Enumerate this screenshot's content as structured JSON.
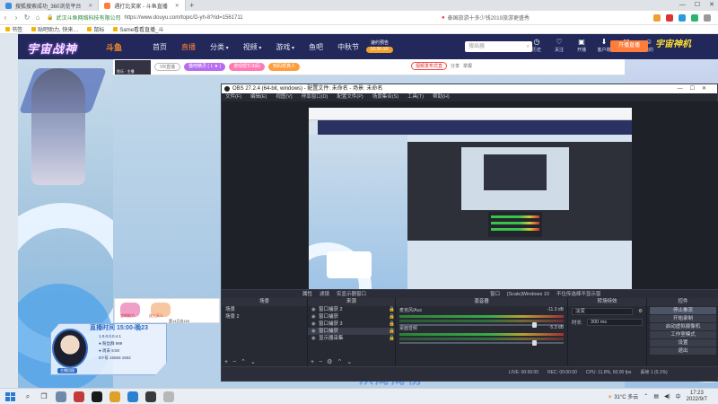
{
  "browser": {
    "tabs": [
      {
        "label": "搜狐搜索成功_360浏览平台",
        "active": false,
        "color": "#3b8de0"
      },
      {
        "label": "遇打比奖家 - 斗鱼直播",
        "active": true,
        "color": "#ff7d3b"
      }
    ],
    "url_site": "武汉斗鱼网络科技有限公司",
    "url": "https://www.douyu.com/topic/D-yh-8?rid=1561711",
    "search_text": "泰国旅游十多少钱2019旅游更盛秀",
    "bookmarks": [
      "书签",
      "贴吧助力, 快来…",
      "鼠标",
      "Same看看直播_斗"
    ],
    "window_controls": [
      "—",
      "☐",
      "✕"
    ]
  },
  "douyu": {
    "logo_text": "宇宙战神",
    "logo_brand": "斗鱼",
    "nav": [
      "首页",
      "直播",
      "分类",
      "视频",
      "游戏",
      "鱼吧",
      "中秋节"
    ],
    "nav_active_index": 1,
    "nav_dropdown": [
      2,
      3,
      4
    ],
    "appointment_title": "速约预告",
    "appointment_time": "16:30-16:",
    "search_placeholder": "搜出器",
    "header_icons": [
      {
        "icon": "history-icon",
        "label": "历史"
      },
      {
        "icon": "follow-icon",
        "label": "关注"
      },
      {
        "icon": "live-icon",
        "label": "开播"
      },
      {
        "icon": "client-icon",
        "label": "客户端"
      },
      {
        "icon": "message-icon",
        "label": "消息"
      },
      {
        "icon": "user-icon",
        "label": "我的"
      }
    ],
    "open_live_label": "开播直播",
    "corner_brand": "宇宙神机",
    "room": {
      "avatar_caption": "鱼乐 · 主播",
      "badges": [
        "VR直播",
        "猫吧精灵 ( 1 ★ )",
        "游戏帮忙出码",
        "知码帮真人"
      ],
      "rank_label": "视频发布式直",
      "share": "分享",
      "report": "举报"
    },
    "bottom_banner": "从周周榜"
  },
  "obs": {
    "title": "OBS 27.2.4 (64-bit, windows) - 配置文件: 未命名 - 场景: 未命名",
    "menu": [
      "文件(F)",
      "编辑(E)",
      "视图(V)",
      "停靠窗口(D)",
      "配置文件(P)",
      "场景集合(S)",
      "工具(T)",
      "帮助(H)"
    ],
    "toolbar": [
      "属性",
      "滤镜",
      "实显示器窗口"
    ],
    "toolbar_right": [
      "窗口",
      "[Scale]Windows 10",
      "不位传选择不显示窗"
    ],
    "docks": {
      "scenes": {
        "title": "场景",
        "items": [
          "场景",
          "场景 2"
        ],
        "selected": 1
      },
      "sources": {
        "title": "来源",
        "items": [
          "窗口捕获 2",
          "窗口捕获",
          "窗口捕获 3",
          "窗口捕获",
          "显示器采集"
        ],
        "selected": 3
      },
      "mixer": {
        "title": "混音器",
        "tracks": [
          {
            "name": "麦克风/Aux",
            "db": "-11.3 dB"
          },
          {
            "name": "桌面音频",
            "db": "-5.3 dB"
          }
        ]
      },
      "transitions": {
        "title": "转场特效",
        "type": "淡变",
        "duration_label": "时长",
        "duration": "300 ms"
      },
      "controls": {
        "title": "控件",
        "buttons": [
          "停止推流",
          "开始录制",
          "启动虚拟摄像机",
          "工作室模式",
          "设置",
          "退出"
        ],
        "highlight": 0
      }
    },
    "status": [
      "LIVE: 00:00:00",
      "REC: 00:00:00",
      "CPU: 11.8%, 60.00 fps",
      "丢帧 1 (0.1%)"
    ]
  },
  "streamer": {
    "schedule": "直播时间 15:00-晚23",
    "lines": [
      "1.0.0.0.0.4.1",
      "● 粉丝群 999",
      "● 周末 9:00",
      "DY号 15583 1502"
    ],
    "tag": "主播回国",
    "chat_labels": [
      "猫吧助力",
      "送三天人"
    ],
    "chat_count": "第14月份150"
  },
  "taskbar": {
    "weather_temp": "31°C",
    "weather_desc": "多云",
    "time": "17:23",
    "date": "2022/9/7",
    "apps": [
      "#6f8aa8",
      "#c43a3a",
      "#1a1a1a",
      "#e1a028",
      "#2d7fd1",
      "#3a3a3a",
      "#b8b8b8"
    ]
  }
}
